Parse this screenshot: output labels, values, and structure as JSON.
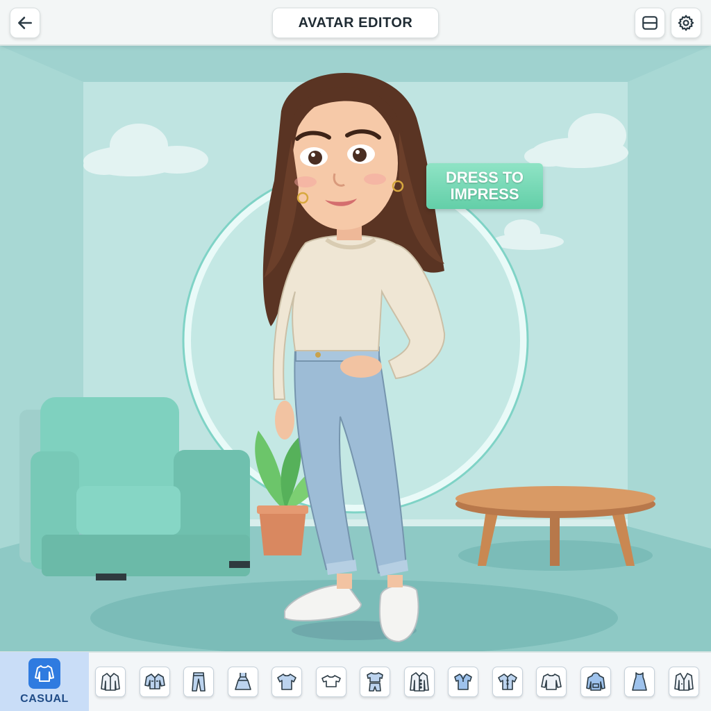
{
  "header": {
    "title": "AVATAR EDITOR",
    "back_icon": "arrow-left-icon",
    "layout_icon": "panel-toggle-icon",
    "settings_icon": "gear-icon"
  },
  "scene": {
    "badge_line1": "DRESS TO",
    "badge_line2": "IMPRESS",
    "avatar": {
      "top": "cream sweater",
      "bottom": "light blue jeans",
      "shoes": "white sneakers"
    }
  },
  "wardrobe": {
    "selected_category": "CASUAL",
    "category_icon": "sweater-icon",
    "items": [
      {
        "icon": "jacket-icon"
      },
      {
        "icon": "denim-jacket-icon"
      },
      {
        "icon": "pants-icon"
      },
      {
        "icon": "dress-icon"
      },
      {
        "icon": "tshirt-icon"
      },
      {
        "icon": "crop-top-icon"
      },
      {
        "icon": "outfit-set-icon"
      },
      {
        "icon": "coat-icon"
      },
      {
        "icon": "polo-shirt-icon"
      },
      {
        "icon": "button-shirt-icon"
      },
      {
        "icon": "sweater-icon"
      },
      {
        "icon": "hoodie-icon"
      },
      {
        "icon": "tank-dress-icon"
      },
      {
        "icon": "blazer-icon"
      }
    ]
  },
  "colors": {
    "accent": "#2f7be0",
    "wall": "#bfe4e1",
    "floor": "#8ec9c5",
    "badge": "#6fd6b0"
  }
}
